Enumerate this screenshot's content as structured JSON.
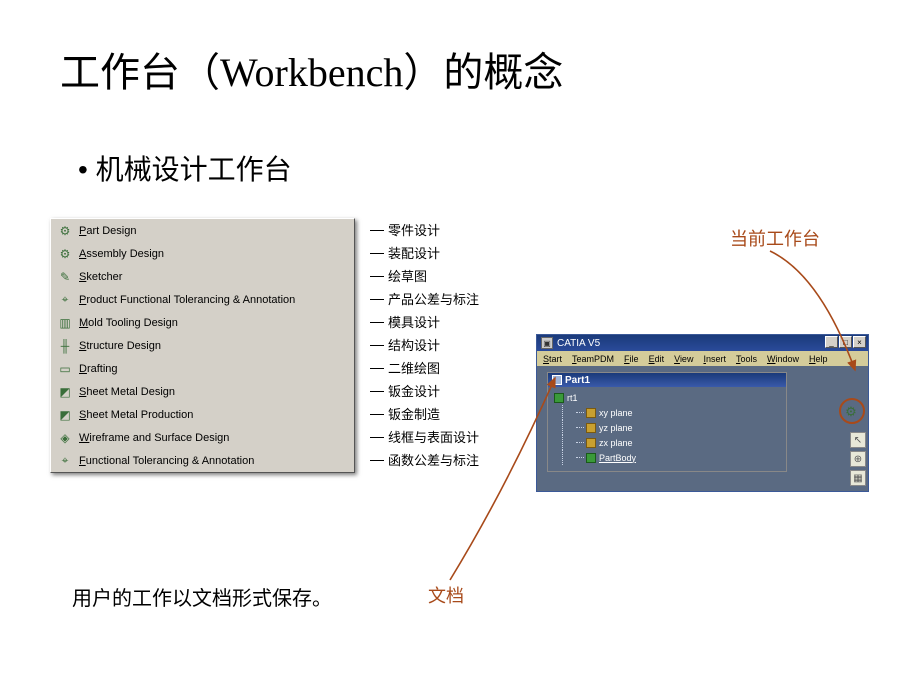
{
  "title": "工作台（Workbench）的概念",
  "bullet": "机械设计工作台",
  "menu": [
    {
      "en": "Part Design",
      "zh": "零件设计",
      "icon": "⚙"
    },
    {
      "en": "Assembly Design",
      "zh": "装配设计",
      "icon": "⚙"
    },
    {
      "en": "Sketcher",
      "zh": "绘草图",
      "icon": "✎"
    },
    {
      "en": "Product Functional Tolerancing & Annotation",
      "zh": "产品公差与标注",
      "icon": "⌖"
    },
    {
      "en": "Mold Tooling Design",
      "zh": "模具设计",
      "icon": "▥"
    },
    {
      "en": "Structure Design",
      "zh": "结构设计",
      "icon": "╫"
    },
    {
      "en": "Drafting",
      "zh": "二维绘图",
      "icon": "▭"
    },
    {
      "en": "Sheet Metal Design",
      "zh": "钣金设计",
      "icon": "◩"
    },
    {
      "en": "Sheet Metal Production",
      "zh": "钣金制造",
      "icon": "◩"
    },
    {
      "en": "Wireframe and Surface Design",
      "zh": "线框与表面设计",
      "icon": "◈"
    },
    {
      "en": "Functional Tolerancing & Annotation",
      "zh": "函数公差与标注",
      "icon": "⌖"
    }
  ],
  "annotations": {
    "current_workbench": "当前工作台",
    "document": "文档"
  },
  "bottom_text": "用户的工作以文档形式保存。",
  "catia": {
    "title": "CATIA V5",
    "menubar": [
      "Start",
      "TeamPDM",
      "File",
      "Edit",
      "View",
      "Insert",
      "Tools",
      "Window",
      "Help"
    ],
    "doc_name": "Part1",
    "tree_root": "rt1",
    "tree_items": [
      "xy plane",
      "yz plane",
      "zx plane",
      "PartBody"
    ]
  }
}
